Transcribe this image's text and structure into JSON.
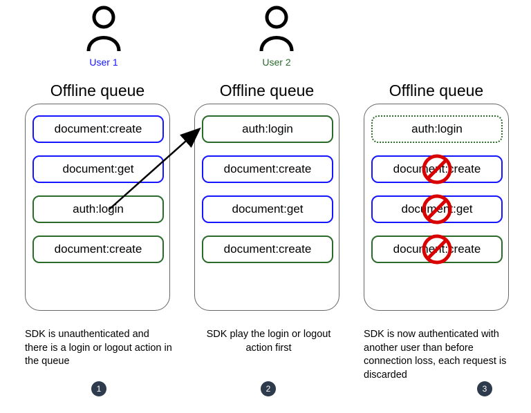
{
  "users": [
    {
      "label": "User 1",
      "color": "#1515ff"
    },
    {
      "label": "User 2",
      "color": "#2a6b2a"
    }
  ],
  "columns": [
    {
      "title": "Offline queue",
      "cells": [
        {
          "text": "document:create",
          "style": "blue"
        },
        {
          "text": "document:get",
          "style": "blue"
        },
        {
          "text": "auth:login",
          "style": "green"
        },
        {
          "text": "document:create",
          "style": "green"
        }
      ],
      "caption": "SDK is unauthenticated and there is a login or logout action in the queue",
      "badge": "1"
    },
    {
      "title": "Offline queue",
      "cells": [
        {
          "text": "auth:login",
          "style": "green"
        },
        {
          "text": "document:create",
          "style": "blue"
        },
        {
          "text": "document:get",
          "style": "blue"
        },
        {
          "text": "document:create",
          "style": "green"
        }
      ],
      "caption": "SDK play the login or logout action first",
      "badge": "2"
    },
    {
      "title": "Offline queue",
      "cells": [
        {
          "text": "auth:login",
          "style": "dotted"
        },
        {
          "text": "document:create",
          "style": "blue",
          "forbidden": true
        },
        {
          "text": "document:get",
          "style": "blue",
          "forbidden": true
        },
        {
          "text": "document:create",
          "style": "green",
          "forbidden": true
        }
      ],
      "caption": "SDK is now authenticated with another user than before connection loss, each request is discarded",
      "badge": "3"
    }
  ],
  "forbidden_icon_color": "#d80000"
}
